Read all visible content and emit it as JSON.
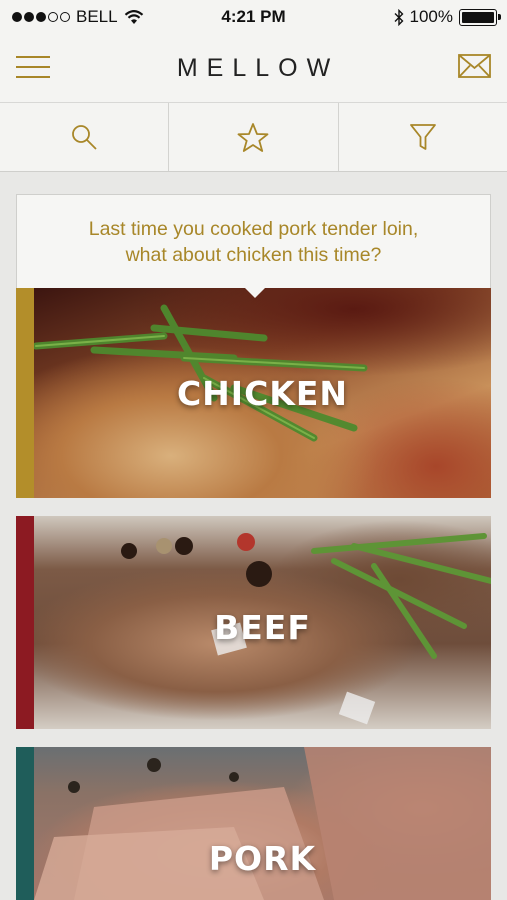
{
  "status_bar": {
    "carrier": "BELL",
    "time": "4:21 PM",
    "battery": "100%",
    "signal_bars": 3,
    "signal_total": 5,
    "battery_level": 1.0
  },
  "header": {
    "brand": "MELLOW",
    "menu_icon": "hamburger-icon",
    "mail_icon": "envelope-icon"
  },
  "toolbar": {
    "items": [
      {
        "icon": "search-icon"
      },
      {
        "icon": "star-icon"
      },
      {
        "icon": "filter-icon"
      }
    ]
  },
  "suggestion": {
    "line1": "Last time you cooked pork tender loin,",
    "line2": "what about chicken this time?"
  },
  "categories": [
    {
      "label": "CHICKEN",
      "color": "#b38e2a"
    },
    {
      "label": "BEEF",
      "color": "#8c1a22"
    },
    {
      "label": "PORK",
      "color": "#1f5d5a"
    }
  ],
  "colors": {
    "accent": "#a88729",
    "background": "#e8e8e6",
    "bar": "#f4f4f2"
  }
}
